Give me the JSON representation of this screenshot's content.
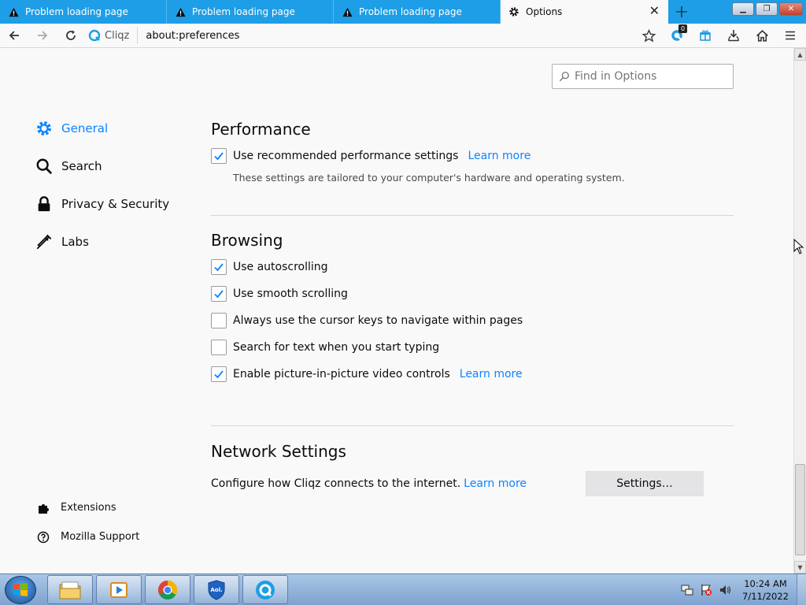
{
  "tabs": [
    {
      "label": "Problem loading page",
      "icon": "warning-icon",
      "active": false
    },
    {
      "label": "Problem loading page",
      "icon": "warning-icon",
      "active": false
    },
    {
      "label": "Problem loading page",
      "icon": "warning-icon",
      "active": false
    },
    {
      "label": "Options",
      "icon": "gear-icon",
      "active": true
    }
  ],
  "navbar": {
    "brand": "Cliqz",
    "url": "about:preferences",
    "badge_count": "0"
  },
  "search": {
    "placeholder": "Find in Options"
  },
  "sidebar": {
    "items": [
      {
        "label": "General",
        "icon": "gear-icon",
        "selected": true
      },
      {
        "label": "Search",
        "icon": "search-icon",
        "selected": false
      },
      {
        "label": "Privacy & Security",
        "icon": "lock-icon",
        "selected": false
      },
      {
        "label": "Labs",
        "icon": "pipette-icon",
        "selected": false
      }
    ],
    "footer": [
      {
        "label": "Extensions",
        "icon": "puzzle-icon"
      },
      {
        "label": "Mozilla Support",
        "icon": "help-icon"
      }
    ]
  },
  "performance": {
    "heading": "Performance",
    "option": {
      "label": "Use recommended performance settings",
      "checked": true,
      "link": "Learn more"
    },
    "description": "These settings are tailored to your computer's hardware and operating system."
  },
  "browsing": {
    "heading": "Browsing",
    "options": [
      {
        "label": "Use autoscrolling",
        "checked": true
      },
      {
        "label": "Use smooth scrolling",
        "checked": true
      },
      {
        "label": "Always use the cursor keys to navigate within pages",
        "checked": false
      },
      {
        "label": "Search for text when you start typing",
        "checked": false
      },
      {
        "label": "Enable picture-in-picture video controls",
        "checked": true,
        "link": "Learn more"
      }
    ]
  },
  "network": {
    "heading": "Network Settings",
    "description": "Configure how Cliqz connects to the internet.",
    "link": "Learn more",
    "button": "Settings…"
  },
  "taskbar": {
    "apps": [
      "file-explorer-icon",
      "media-player-icon",
      "chrome-icon",
      "aol-shield-icon",
      "cliqz-icon"
    ],
    "time": "10:24 AM",
    "date": "7/11/2022"
  },
  "colors": {
    "tabstrip": "#1e9ee6",
    "accent": "#0a84ff",
    "page_bg": "#f9f9fa"
  }
}
